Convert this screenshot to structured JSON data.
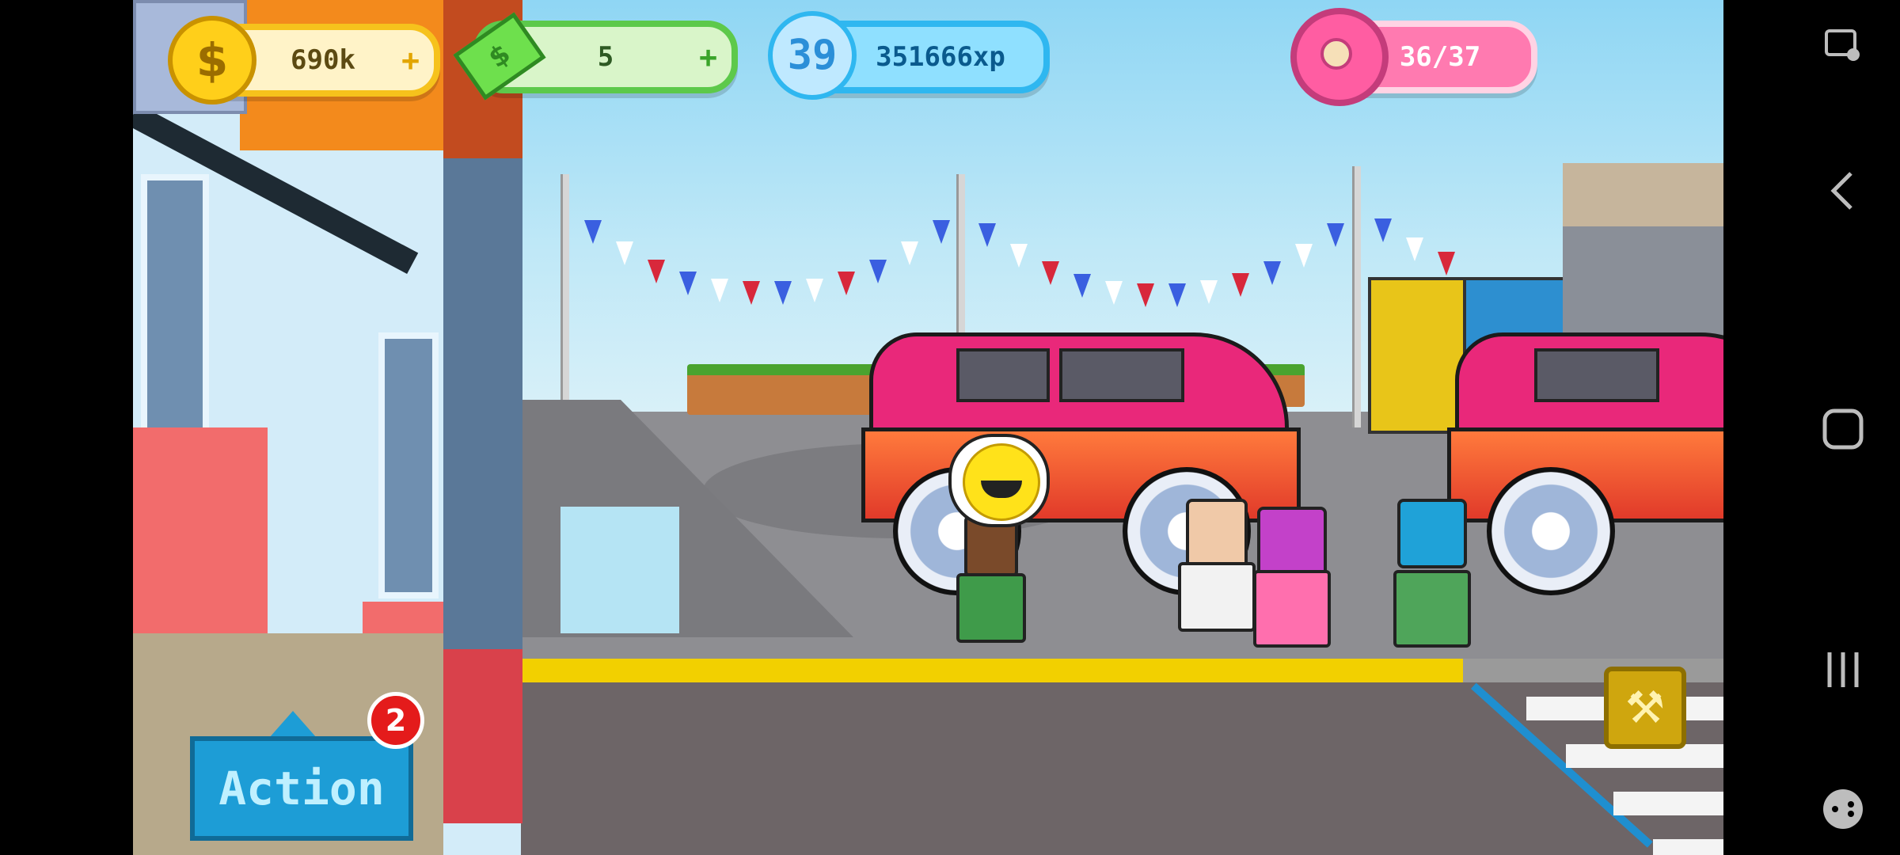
{
  "hud": {
    "coins": "690k",
    "coins_plus": "+",
    "cash": "5",
    "cash_plus": "+",
    "level": "39",
    "xp": "351666xp",
    "donuts": "36/37",
    "coin_icon_symbol": "$"
  },
  "actions": {
    "action_label": "Action",
    "action_badge": "2",
    "wrench_symbol": "🔧"
  },
  "colors": {
    "car": "#e9287a",
    "curb": "#f2d000",
    "sky": "#8fd6f4"
  },
  "icons": {
    "coin": "coin-icon",
    "cash": "cash-icon",
    "level": "level-star-icon",
    "donut": "donut-icon",
    "wrench": "wrench-icon",
    "nav_screenshot": "screenshot-icon",
    "nav_back": "back-icon",
    "nav_home": "home-icon",
    "nav_recents": "recents-icon",
    "nav_gamepad": "gamepad-icon"
  }
}
